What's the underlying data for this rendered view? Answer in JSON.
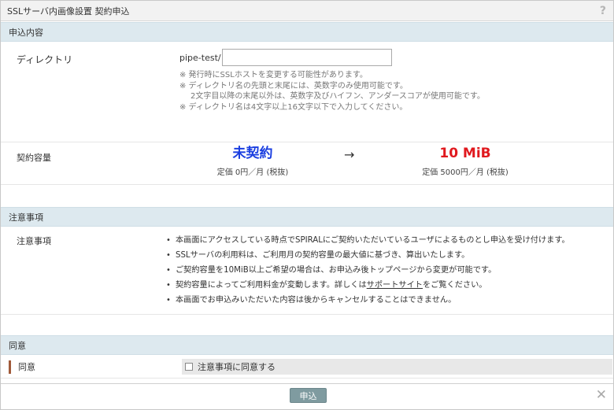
{
  "window": {
    "title": "SSLサーバ内画像設置 契約申込",
    "help": "?"
  },
  "sections": {
    "application": "申込内容",
    "notice": "注意事項",
    "consent": "同意"
  },
  "directory": {
    "label": "ディレクトリ",
    "prefix": "pipe-test/",
    "value": "",
    "notes": [
      "※ 発行時にSSLホストを変更する可能性があります。",
      "※ ディレクトリ名の先頭と末尾には、英数字のみ使用可能です。",
      "2文字目以降の末尾以外は、英数字及びハイフン、アンダースコアが使用可能です。",
      "※ ディレクトリ名は4文字以上16文字以下で入力してください。"
    ]
  },
  "capacity": {
    "label": "契約容量",
    "current": "未契約",
    "current_price": "定価 0円／月 (税抜)",
    "arrow": "→",
    "new": "10 MiB",
    "new_price": "定価 5000円／月 (税抜)",
    "colors": {
      "current": "#1a3ee0",
      "new": "#e0191e"
    }
  },
  "notice": {
    "label": "注意事項",
    "items": [
      "本画面にアクセスしている時点でSPIRALにご契約いただいているユーザによるものとし申込を受け付けます。",
      "SSLサーバの利用料は、ご利用月の契約容量の最大値に基づき、算出いたします。",
      "ご契約容量を10MiB以上ご希望の場合は、お申込み後トップページから変更が可能です。",
      "本画面でお申込みいただいた内容は後からキャンセルすることはできません。"
    ],
    "item4_pre": "契約容量によってご利用料金が変動します。詳しくは",
    "item4_link": "サポートサイト",
    "item4_post": "をご覧ください。"
  },
  "consent": {
    "label": "同意",
    "checkbox_label": "注意事項に同意する",
    "checked": false
  },
  "footer": {
    "submit": "申込",
    "close": "✕"
  }
}
